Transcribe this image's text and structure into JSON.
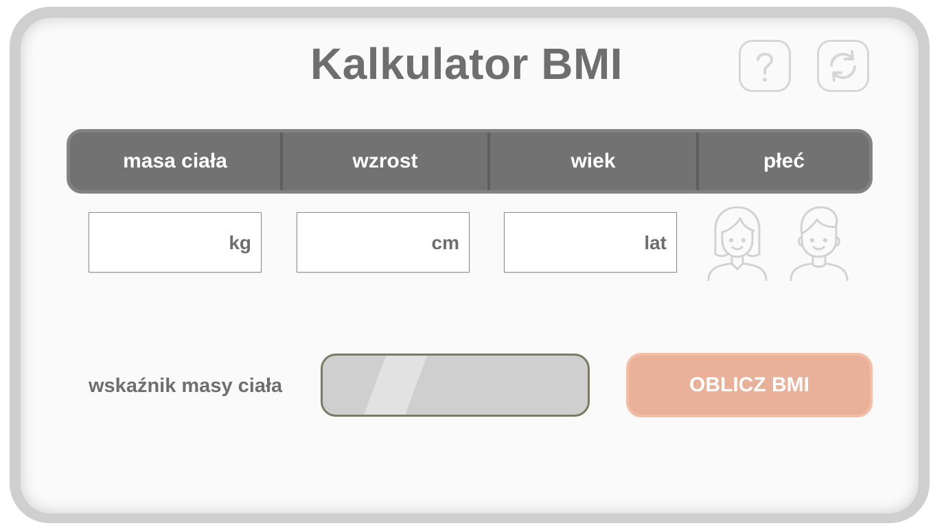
{
  "app": {
    "title": "Kalkulator BMI"
  },
  "toolbar": {
    "help_icon": "question-mark-icon",
    "reset_icon": "refresh-icon"
  },
  "columns": [
    {
      "label": "masa ciała"
    },
    {
      "label": "wzrost"
    },
    {
      "label": "wiek"
    },
    {
      "label": "płeć"
    }
  ],
  "inputs": {
    "weight": {
      "value": "",
      "unit": "kg"
    },
    "height": {
      "value": "",
      "unit": "cm"
    },
    "age": {
      "value": "",
      "unit": "lat"
    }
  },
  "gender": {
    "options": [
      {
        "icon": "female-avatar-icon"
      },
      {
        "icon": "male-avatar-icon"
      }
    ]
  },
  "result": {
    "label": "wskaźnik masy ciała",
    "value": ""
  },
  "actions": {
    "calculate_label": "OBLICZ BMI"
  },
  "colors": {
    "header_bar": "#727272",
    "button": "#e9b19a",
    "result_box": "#cfcfcf",
    "icon_stroke": "#d6d6d6"
  }
}
